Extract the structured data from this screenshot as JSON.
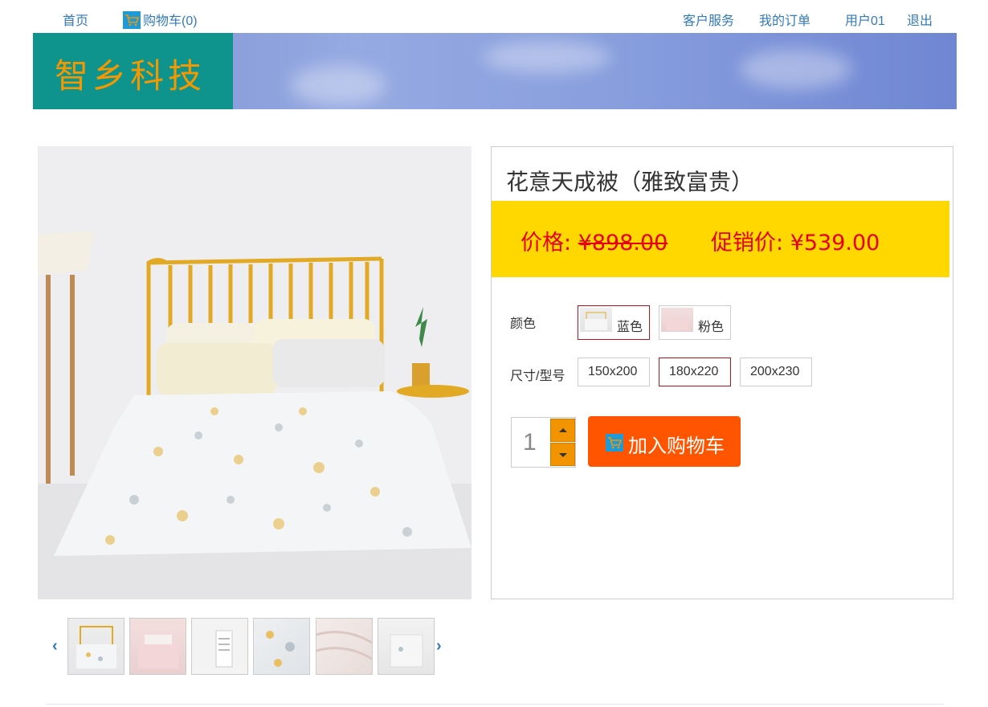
{
  "nav": {
    "home": "首页",
    "cart": "购物车(0)",
    "service": "客户服务",
    "orders": "我的订单",
    "user": "用户01",
    "logout": "退出"
  },
  "banner": {
    "logo": "智乡科技"
  },
  "product": {
    "title": "花意天成被（雅致富贵）",
    "price_label": "价格: ",
    "price": "¥898.00",
    "promo_label": "促销价: ",
    "promo_price": "¥539.00",
    "color_label": "颜色",
    "colors": [
      {
        "name": "蓝色",
        "selected": true
      },
      {
        "name": "粉色",
        "selected": false
      }
    ],
    "size_label": "尺寸/型号",
    "sizes": [
      {
        "name": "150x200",
        "selected": false
      },
      {
        "name": "180x220",
        "selected": true
      },
      {
        "name": "200x230",
        "selected": false
      }
    ],
    "quantity": "1",
    "add_to_cart": "加入购物车"
  },
  "thumbnails": [
    "thumb-bed-blue",
    "thumb-bed-pink",
    "thumb-label",
    "thumb-fabric-yellow",
    "thumb-fabric-pink",
    "thumb-chair"
  ],
  "colors": {
    "link": "#337ab7",
    "logo_bg": "#0e948c",
    "logo_text": "#f39800",
    "price_bg": "#ffd800",
    "price_text": "#e60012",
    "button": "#ff5500",
    "selected_border": "#b3121f"
  }
}
